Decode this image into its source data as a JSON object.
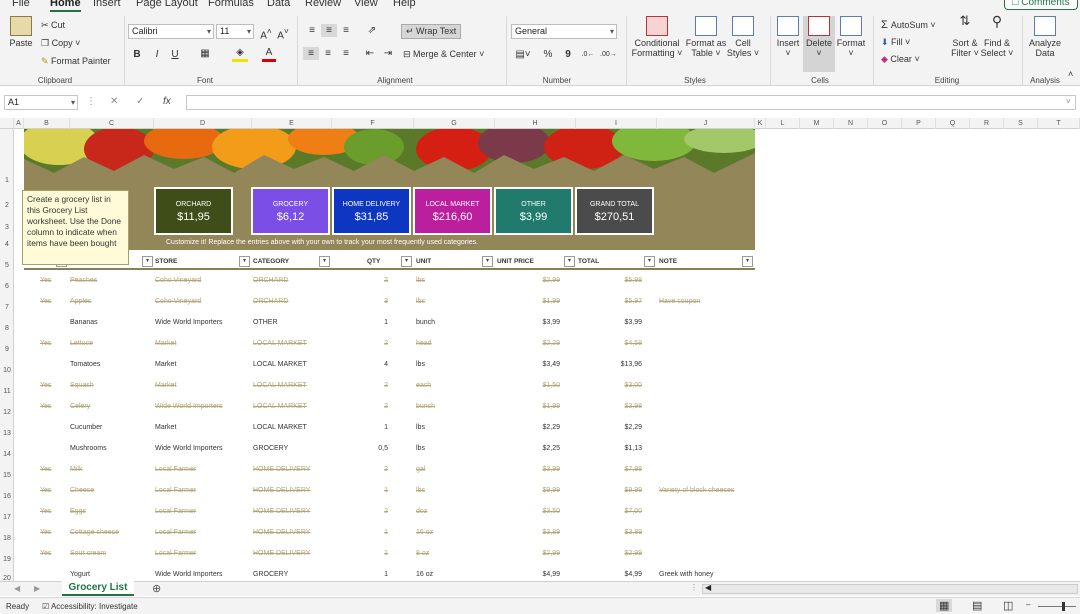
{
  "menu": {
    "items": [
      "File",
      "Home",
      "Insert",
      "Page Layout",
      "Formulas",
      "Data",
      "Review",
      "View",
      "Help"
    ],
    "active": "Home",
    "comments_label": "Comments"
  },
  "ribbon": {
    "clipboard": {
      "label": "Clipboard",
      "paste": "Paste",
      "cut": "Cut",
      "copy": "Copy",
      "format_painter": "Format Painter"
    },
    "font": {
      "label": "Font",
      "name": "Calibri",
      "size": "11",
      "bold": "B",
      "italic": "I",
      "underline": "U"
    },
    "alignment": {
      "label": "Alignment",
      "wrap": "Wrap Text",
      "merge": "Merge & Center"
    },
    "number": {
      "label": "Number",
      "format": "General",
      "percent": "%",
      "comma": "9"
    },
    "styles": {
      "label": "Styles",
      "conditional": [
        "Conditional",
        "Formatting"
      ],
      "format_table": [
        "Format as",
        "Table"
      ],
      "cell_styles": [
        "Cell",
        "Styles"
      ]
    },
    "cells": {
      "label": "Cells",
      "insert": "Insert",
      "delete": "Delete",
      "format": "Format"
    },
    "editing": {
      "label": "Editing",
      "autosum": "AutoSum",
      "fill": "Fill",
      "clear": "Clear",
      "sort": [
        "Sort &",
        "Filter"
      ],
      "find": [
        "Find &",
        "Select"
      ]
    },
    "analysis": {
      "label": "Analysis",
      "analyze": [
        "Analyze",
        "Data"
      ]
    }
  },
  "formula_bar": {
    "name_box": "A1",
    "fx": "fx"
  },
  "columns": [
    "A",
    "B",
    "C",
    "D",
    "E",
    "F",
    "G",
    "H",
    "I",
    "J",
    "K",
    "L",
    "M",
    "N",
    "O",
    "P",
    "Q",
    "R",
    "S",
    "T"
  ],
  "row_numbers": [
    "1",
    "2",
    "3",
    "4",
    "5",
    "6",
    "7",
    "8",
    "9",
    "10",
    "11",
    "12",
    "13",
    "14",
    "15",
    "16",
    "17",
    "18",
    "19",
    "20"
  ],
  "tiles": [
    {
      "label": "ORCHARD",
      "value": "$11,95",
      "color": "#3f4e19"
    },
    {
      "label": "GROCERY",
      "value": "$6,12",
      "color": "#7b4fe6"
    },
    {
      "label": "HOME DELIVERY",
      "value": "$31,85",
      "color": "#0d37c0"
    },
    {
      "label": "LOCAL MARKET",
      "value": "$216,60",
      "color": "#bb1f9e"
    },
    {
      "label": "OTHER",
      "value": "$3,99",
      "color": "#207b6d"
    },
    {
      "label": "GRAND TOTAL",
      "value": "$270,51",
      "color": "#4b4b4b"
    }
  ],
  "customize_text": "Customize it! Replace the entries above with your own to track your most frequently used categories.",
  "tooltip": "Create a grocery list in this Grocery List worksheet. Use the Done column to indicate when items have been bought",
  "headers": {
    "store": "STORE",
    "category": "CATEGORY",
    "qty": "QTY",
    "unit": "UNIT",
    "unit_price": "UNIT PRICE",
    "total": "TOTAL",
    "note": "NOTE"
  },
  "rows": [
    {
      "done": "Yes",
      "item": "Peaches",
      "store": "Coho Vineyard",
      "category": "ORCHARD",
      "qty": "2",
      "unit": "lbs",
      "price": "$2,99",
      "total": "$5,98",
      "note": ""
    },
    {
      "done": "Yes",
      "item": "Apples",
      "store": "Coho Vineyard",
      "category": "ORCHARD",
      "qty": "3",
      "unit": "lbs",
      "price": "$1,99",
      "total": "$5,97",
      "note": "Have coupon"
    },
    {
      "done": "",
      "item": "Bananas",
      "store": "Wide World Importers",
      "category": "OTHER",
      "qty": "1",
      "unit": "bunch",
      "price": "$3,99",
      "total": "$3,99",
      "note": ""
    },
    {
      "done": "Yes",
      "item": "Lettuce",
      "store": "Market",
      "category": "LOCAL MARKET",
      "qty": "2",
      "unit": "head",
      "price": "$2,29",
      "total": "$4,58",
      "note": ""
    },
    {
      "done": "",
      "item": "Tomatoes",
      "store": "Market",
      "category": "LOCAL MARKET",
      "qty": "4",
      "unit": "lbs",
      "price": "$3,49",
      "total": "$13,96",
      "note": ""
    },
    {
      "done": "Yes",
      "item": "Squash",
      "store": "Market",
      "category": "LOCAL MARKET",
      "qty": "2",
      "unit": "each",
      "price": "$1,50",
      "total": "$3,00",
      "note": ""
    },
    {
      "done": "Yes",
      "item": "Celery",
      "store": "Wide World Importers",
      "category": "LOCAL MARKET",
      "qty": "2",
      "unit": "bunch",
      "price": "$1,99",
      "total": "$3,98",
      "note": ""
    },
    {
      "done": "",
      "item": "Cucumber",
      "store": "Market",
      "category": "LOCAL MARKET",
      "qty": "1",
      "unit": "lbs",
      "price": "$2,29",
      "total": "$2,29",
      "note": ""
    },
    {
      "done": "",
      "item": "Mushrooms",
      "store": "Wide World Importers",
      "category": "GROCERY",
      "qty": "0,5",
      "unit": "lbs",
      "price": "$2,25",
      "total": "$1,13",
      "note": ""
    },
    {
      "done": "Yes",
      "item": "Milk",
      "store": "Local Farmer",
      "category": "HOME DELIVERY",
      "qty": "2",
      "unit": "gal",
      "price": "$3,99",
      "total": "$7,98",
      "note": ""
    },
    {
      "done": "Yes",
      "item": "Cheese",
      "store": "Local Farmer",
      "category": "HOME DELIVERY",
      "qty": "1",
      "unit": "lbs",
      "price": "$9,99",
      "total": "$9,99",
      "note": "Variety of block cheeses"
    },
    {
      "done": "Yes",
      "item": "Eggs",
      "store": "Local Farmer",
      "category": "HOME DELIVERY",
      "qty": "2",
      "unit": "doz",
      "price": "$3,50",
      "total": "$7,00",
      "note": ""
    },
    {
      "done": "Yes",
      "item": "Cottage cheese",
      "store": "Local Farmer",
      "category": "HOME DELIVERY",
      "qty": "1",
      "unit": "16 oz",
      "price": "$3,89",
      "total": "$3,89",
      "note": ""
    },
    {
      "done": "Yes",
      "item": "Sour cream",
      "store": "Local Farmer",
      "category": "HOME DELIVERY",
      "qty": "1",
      "unit": "8 oz",
      "price": "$2,99",
      "total": "$2,99",
      "note": ""
    },
    {
      "done": "",
      "item": "Yogurt",
      "store": "Wide World Importers",
      "category": "GROCERY",
      "qty": "1",
      "unit": "16 oz",
      "price": "$4,99",
      "total": "$4,99",
      "note": "Greek with honey"
    }
  ],
  "sheet_tab": "Grocery List",
  "status": {
    "ready": "Ready",
    "accessibility": "Accessibility: Investigate"
  }
}
